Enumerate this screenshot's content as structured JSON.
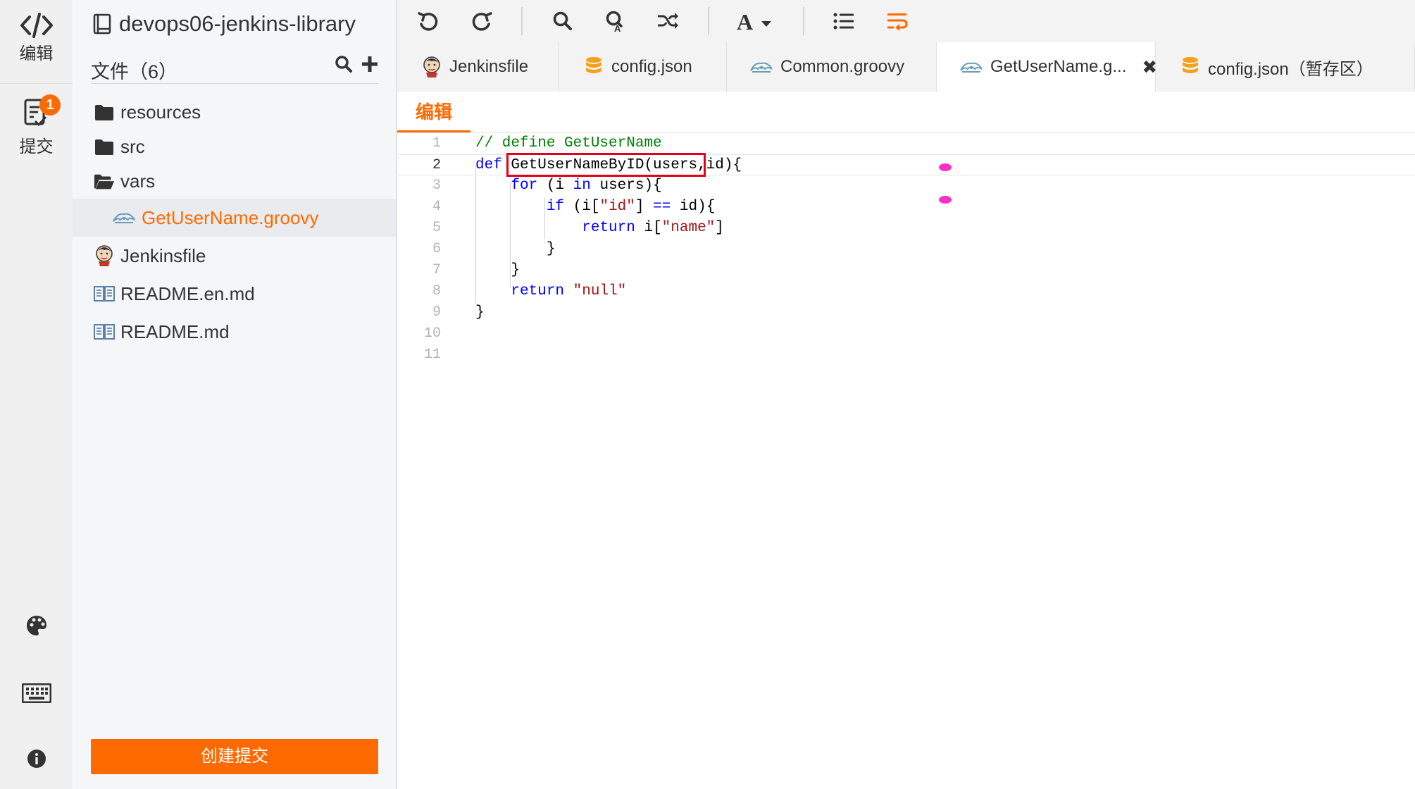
{
  "activity": {
    "edit_label": "编辑",
    "commit_label": "提交",
    "commit_badge": "1",
    "icons": [
      "code-icon",
      "commit-icon",
      "palette-icon",
      "keyboard-icon",
      "info-icon"
    ]
  },
  "explorer": {
    "repo_name": "devops06-jenkins-library",
    "files_heading": "文件（6）",
    "tree": [
      {
        "label": "resources",
        "type": "folder"
      },
      {
        "label": "src",
        "type": "folder"
      },
      {
        "label": "vars",
        "type": "folder-open"
      },
      {
        "label": "GetUserName.groovy",
        "type": "groovy",
        "active": true
      },
      {
        "label": "Jenkinsfile",
        "type": "jenkins"
      },
      {
        "label": "README.en.md",
        "type": "markdown"
      },
      {
        "label": "README.md",
        "type": "markdown"
      }
    ],
    "create_commit_label": "创建提交"
  },
  "toolbar": {
    "buttons": [
      "undo",
      "redo",
      "search",
      "replace",
      "shuffle",
      "font",
      "list",
      "wrap"
    ],
    "accent_color": "#ff6a00"
  },
  "tabs": [
    {
      "label": "Jenkinsfile",
      "icon": "jenkins-icon"
    },
    {
      "label": "config.json",
      "icon": "database-icon"
    },
    {
      "label": "Common.groovy",
      "icon": "groovy-icon"
    },
    {
      "label": "GetUserName.g...",
      "icon": "groovy-icon",
      "active": true,
      "closable": true
    },
    {
      "label": "config.json（暂存区）",
      "icon": "database-icon"
    }
  ],
  "subtab": {
    "label": "编辑"
  },
  "editor": {
    "current_line": 2,
    "line_numbers": [
      "1",
      "2",
      "3",
      "4",
      "5",
      "6",
      "7",
      "8",
      "9",
      "10",
      "11"
    ],
    "lines": [
      {
        "n": "1",
        "parts": [
          [
            "c",
            "// define GetUserName"
          ]
        ]
      },
      {
        "n": "2",
        "parts": [
          [
            "k",
            "def"
          ],
          [
            "t",
            " "
          ],
          [
            "t",
            "GetUserNameByID(users,id)"
          ],
          [
            "t",
            "{"
          ]
        ]
      },
      {
        "n": "3",
        "parts": [
          [
            "t",
            "    "
          ],
          [
            "k",
            "for"
          ],
          [
            "t",
            " (i "
          ],
          [
            "k",
            "in"
          ],
          [
            "t",
            " users){"
          ]
        ]
      },
      {
        "n": "4",
        "parts": [
          [
            "t",
            "        "
          ],
          [
            "k",
            "if"
          ],
          [
            "t",
            " (i["
          ],
          [
            "s",
            "\"id\""
          ],
          [
            "t",
            "] "
          ],
          [
            "k",
            "=="
          ],
          [
            "t",
            " id){"
          ]
        ]
      },
      {
        "n": "5",
        "parts": [
          [
            "t",
            "            "
          ],
          [
            "k",
            "return"
          ],
          [
            "t",
            " i["
          ],
          [
            "s",
            "\"name\""
          ],
          [
            "t",
            "]"
          ]
        ]
      },
      {
        "n": "6",
        "parts": [
          [
            "t",
            "        }"
          ]
        ]
      },
      {
        "n": "7",
        "parts": [
          [
            "t",
            "    }"
          ]
        ]
      },
      {
        "n": "8",
        "parts": [
          [
            "t",
            "    "
          ],
          [
            "k",
            "return"
          ],
          [
            "t",
            " "
          ],
          [
            "s",
            "\"null\""
          ]
        ]
      },
      {
        "n": "9",
        "parts": [
          [
            "t",
            "}"
          ]
        ]
      },
      {
        "n": "10",
        "parts": []
      },
      {
        "n": "11",
        "parts": []
      }
    ],
    "colors": {
      "keyword": "#0000ff",
      "string": "#a31515",
      "comment": "#008000",
      "highlight_box": "#e3001b"
    }
  }
}
